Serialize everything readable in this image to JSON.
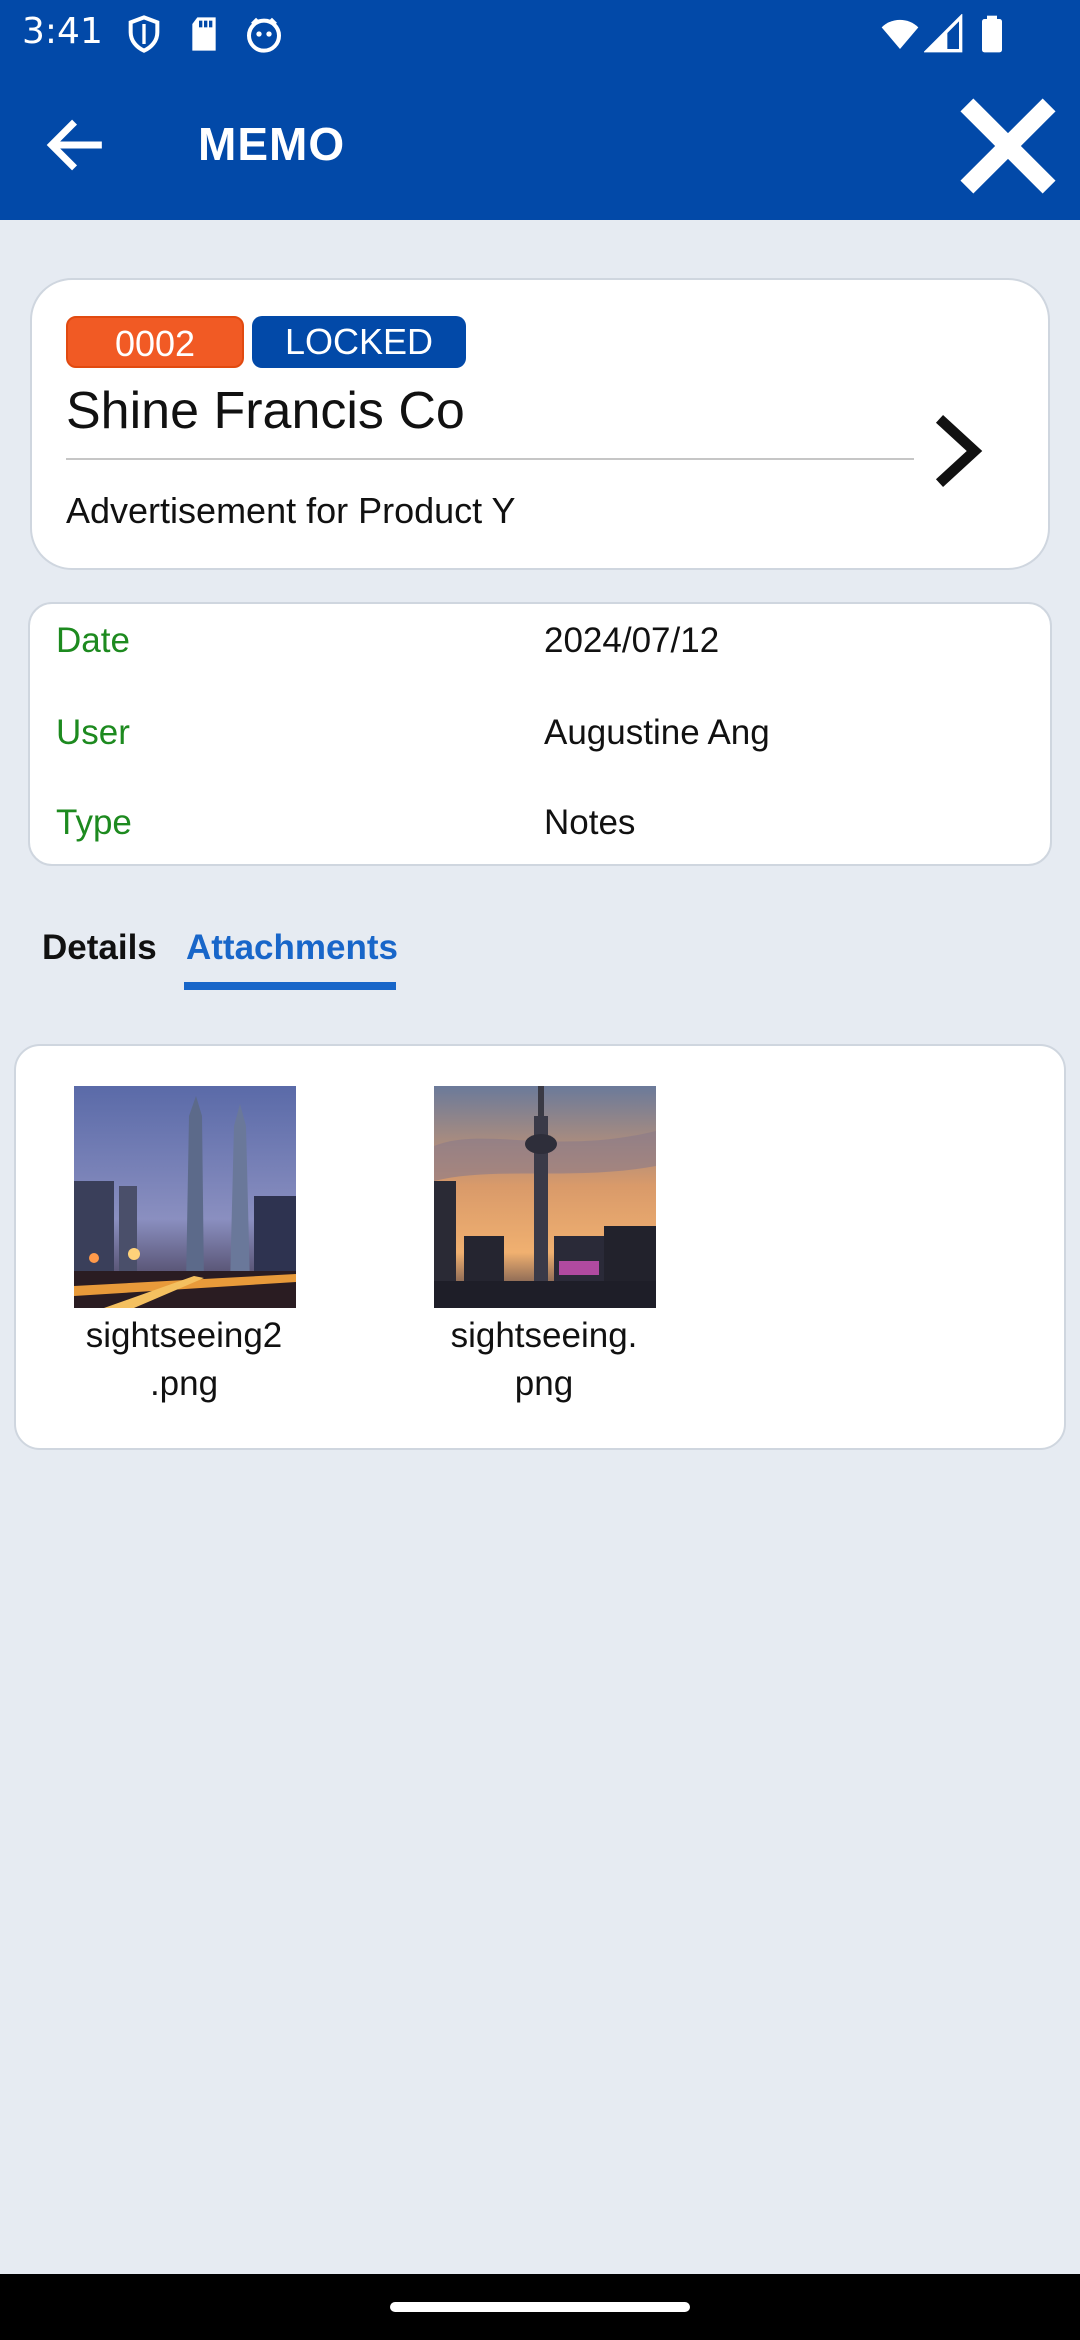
{
  "status_bar": {
    "time": "3:41",
    "icons": [
      "shield-icon",
      "sd-card-icon",
      "face-icon",
      "wifi-icon",
      "signal-icon",
      "battery-icon"
    ]
  },
  "app_bar": {
    "title": "MEMO",
    "back_icon": "arrow-left-icon",
    "close_icon": "close-icon"
  },
  "memo": {
    "id": "0002",
    "status": "LOCKED",
    "company": "Shine Francis Co",
    "subject": "Advertisement for Product Y"
  },
  "info": {
    "rows": [
      {
        "label": "Date",
        "value": "2024/07/12"
      },
      {
        "label": "User",
        "value": "Augustine Ang"
      },
      {
        "label": "Type",
        "value": "Notes"
      }
    ]
  },
  "tabs": [
    {
      "label": "Details",
      "active": false
    },
    {
      "label": "Attachments",
      "active": true
    }
  ],
  "attachments": [
    {
      "name_line1": "sightseeing2",
      "name_line2": ".png"
    },
    {
      "name_line1": "sightseeing.",
      "name_line2": "png"
    }
  ],
  "colors": {
    "primary": "#0249a8",
    "badge_orange": "#f15a24",
    "label_green": "#1d8a1f",
    "tab_active": "#1866c9",
    "background": "#e6ebf2"
  }
}
